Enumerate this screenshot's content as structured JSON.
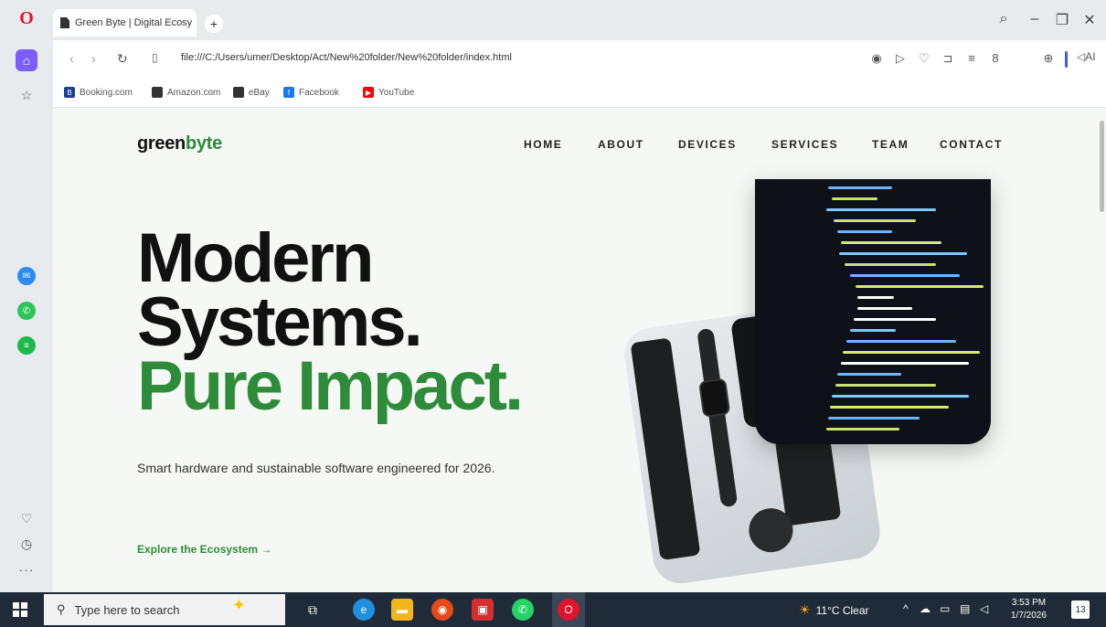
{
  "browser": {
    "tab_title": "Green Byte | Digital Ecosy",
    "new_tab": "+",
    "url": "file:///C:/Users/umer/Desktop/Act/New%20folder/New%20folder/index.html",
    "ai_label": "AI",
    "bookmarks": [
      {
        "label": "Booking.com",
        "color": "#1b3f96"
      },
      {
        "label": "Amazon.com",
        "color": "#333333"
      },
      {
        "label": "eBay",
        "color": "#333333"
      },
      {
        "label": "Facebook",
        "color": "#1877f2"
      },
      {
        "label": "YouTube",
        "color": "#ff0000"
      }
    ]
  },
  "site": {
    "logo_part1": "green",
    "logo_part2": "byte",
    "nav": [
      "HOME",
      "ABOUT",
      "DEVICES",
      "SERVICES",
      "TEAM",
      "CONTACT"
    ],
    "hero_line1": "Modern",
    "hero_line2": "Systems.",
    "hero_line3": "Pure Impact.",
    "subtitle": "Smart hardware and sustainable software engineered for 2026.",
    "cta": "Explore the Ecosystem →",
    "accent_color": "#2e8b3a"
  },
  "taskbar": {
    "search_placeholder": "Type here to search",
    "weather": "11°C  Clear",
    "time": "3:53 PM",
    "date": "1/7/2026",
    "notifications": "13"
  }
}
